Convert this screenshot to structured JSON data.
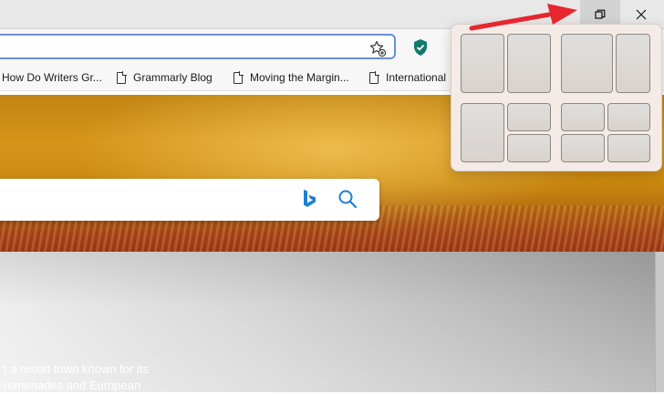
{
  "window_controls": {
    "restore_icon": "restore-icon",
    "close_icon": "close-icon"
  },
  "toolbar": {
    "favorites_icon": "add-favorite-star-icon",
    "extension_icon": "shield-check-icon"
  },
  "bookmarks": [
    {
      "label": "How Do Writers Gr..."
    },
    {
      "label": "Grammarly Blog"
    },
    {
      "label": "Moving the Margin..."
    },
    {
      "label": "International"
    }
  ],
  "search": {
    "bing_icon": "bing-icon",
    "search_icon": "search-icon"
  },
  "news": {
    "line1": "t a resort town known for its",
    "line2": "romenades and European"
  },
  "snap_layouts": {
    "layouts": [
      {
        "name": "two-halves",
        "zones": 2
      },
      {
        "name": "wide-narrow",
        "zones": 2
      },
      {
        "name": "left-half-two-right",
        "zones": 3
      },
      {
        "name": "four-quadrants",
        "zones": 4
      }
    ]
  },
  "colors": {
    "accent": "#6a8ed6",
    "arrow": "#e8262e",
    "shield": "#0f7b6c",
    "bing": "#1e7fd6"
  }
}
